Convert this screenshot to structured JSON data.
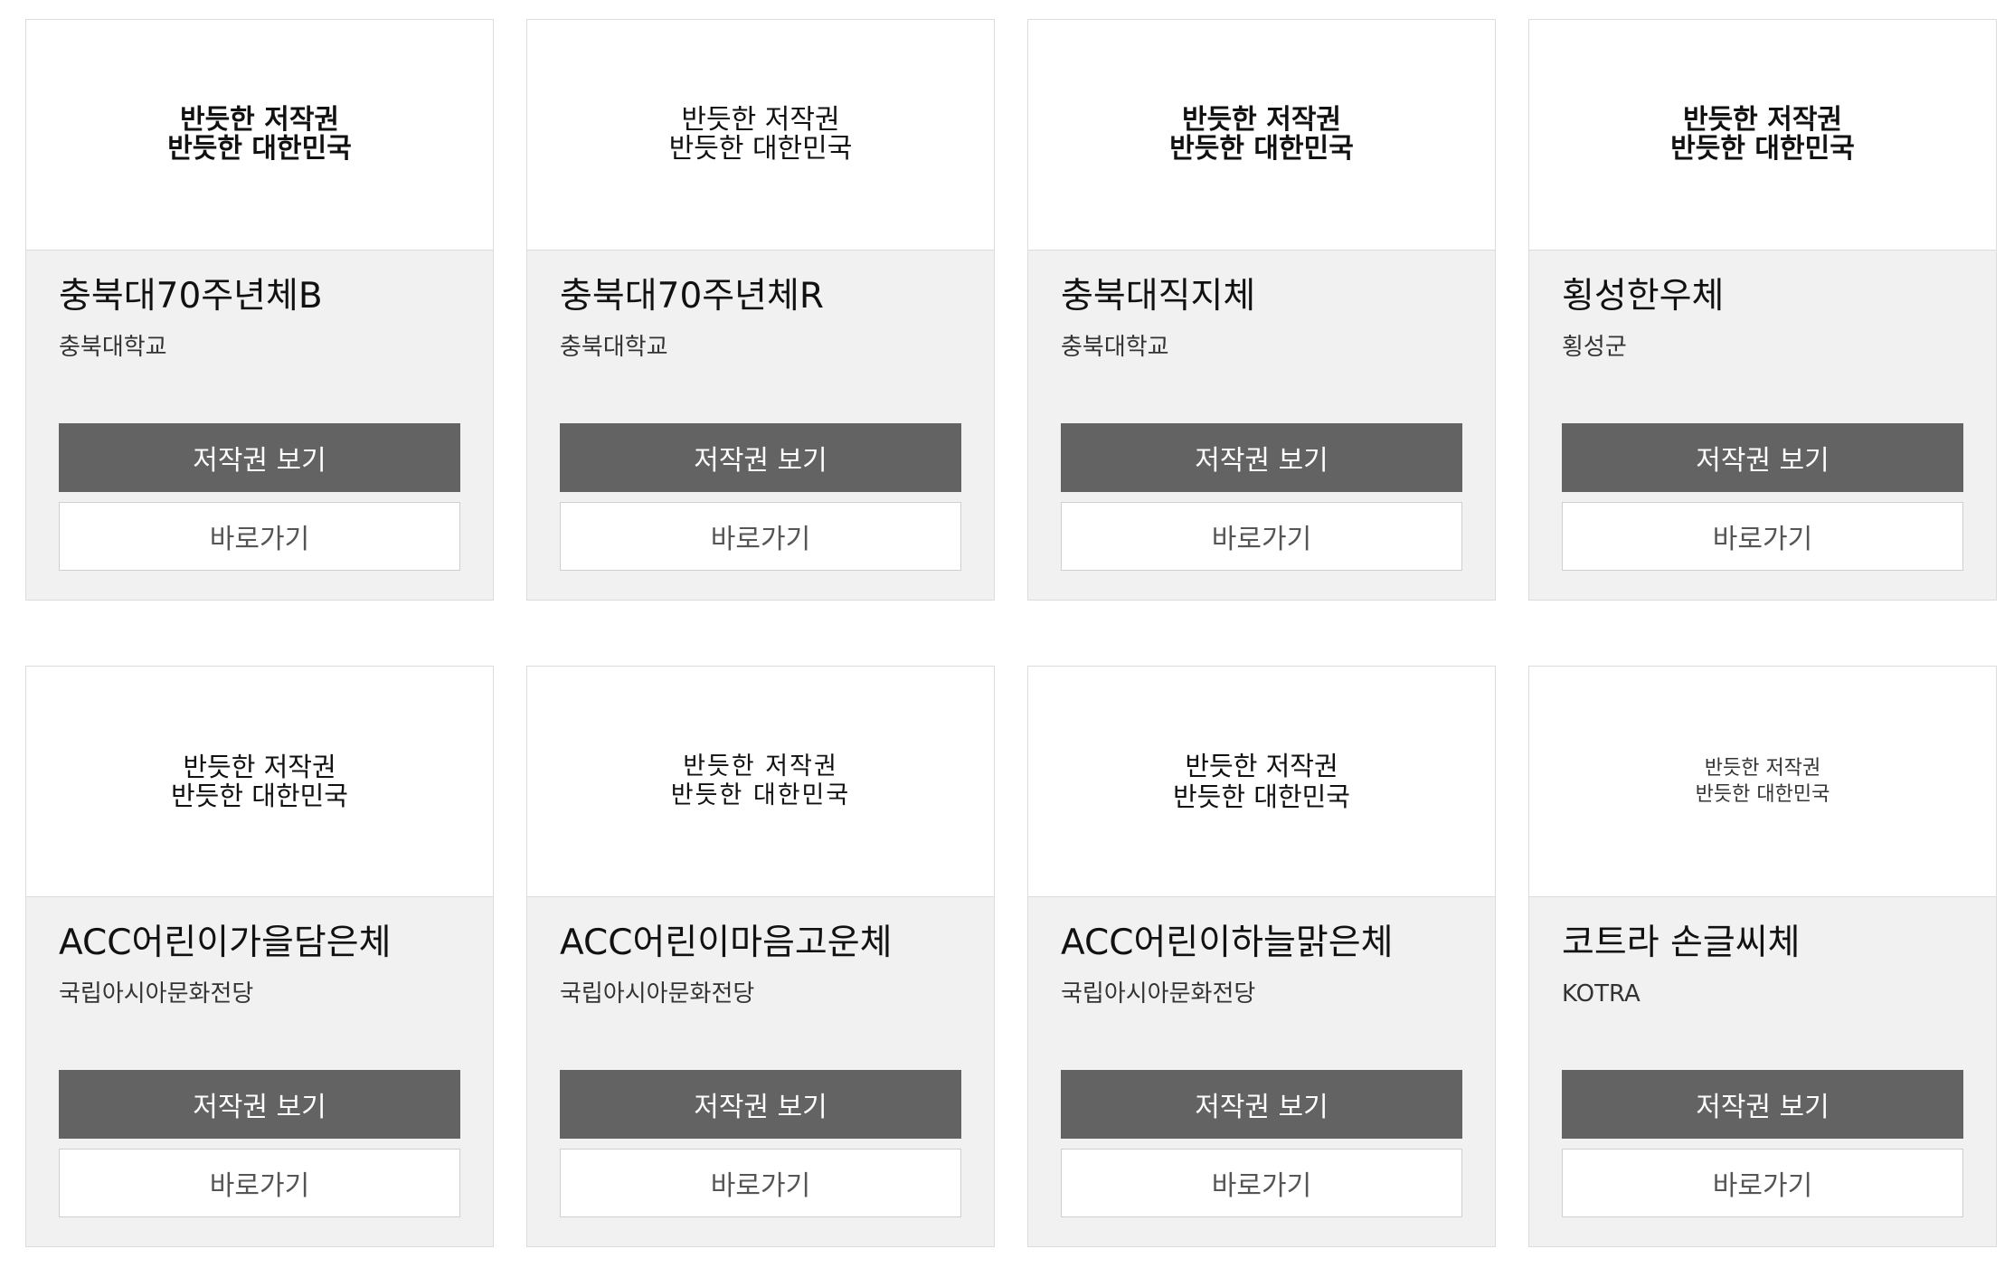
{
  "cards": [
    {
      "preview_text": "반듯한 저작권\n반듯한 대한민국",
      "font_name": "충북대70주년체B",
      "maker": "충북대학교",
      "copyright_button": "저작권 보기",
      "goto_button": "바로가기"
    },
    {
      "preview_text": "반듯한 저작권\n반듯한 대한민국",
      "font_name": "충북대70주년체R",
      "maker": "충북대학교",
      "copyright_button": "저작권 보기",
      "goto_button": "바로가기"
    },
    {
      "preview_text": "반듯한 저작권\n반듯한 대한민국",
      "font_name": "충북대직지체",
      "maker": "충북대학교",
      "copyright_button": "저작권 보기",
      "goto_button": "바로가기"
    },
    {
      "preview_text": "반듯한 저작권\n반듯한 대한민국",
      "font_name": "횡성한우체",
      "maker": "횡성군",
      "copyright_button": "저작권 보기",
      "goto_button": "바로가기"
    },
    {
      "preview_text": "반듯한 저작권\n반듯한 대한민국",
      "font_name": "ACC어린이가을담은체",
      "maker": "국립아시아문화전당",
      "copyright_button": "저작권 보기",
      "goto_button": "바로가기"
    },
    {
      "preview_text": "반듯한 저작권\n반듯한 대한민국",
      "font_name": "ACC어린이마음고운체",
      "maker": "국립아시아문화전당",
      "copyright_button": "저작권 보기",
      "goto_button": "바로가기"
    },
    {
      "preview_text": "반듯한 저작권\n반듯한 대한민국",
      "font_name": "ACC어린이하늘맑은체",
      "maker": "국립아시아문화전당",
      "copyright_button": "저작권 보기",
      "goto_button": "바로가기"
    },
    {
      "preview_text": "반듯한 저작권\n반듯한 대한민국",
      "font_name": "코트라 손글씨체",
      "maker": "KOTRA",
      "copyright_button": "저작권 보기",
      "goto_button": "바로가기"
    }
  ],
  "colors": {
    "card_bg": "#f1f1f1",
    "primary_button": "#636363",
    "secondary_button": "#ffffff",
    "border": "#dcdcdc"
  }
}
